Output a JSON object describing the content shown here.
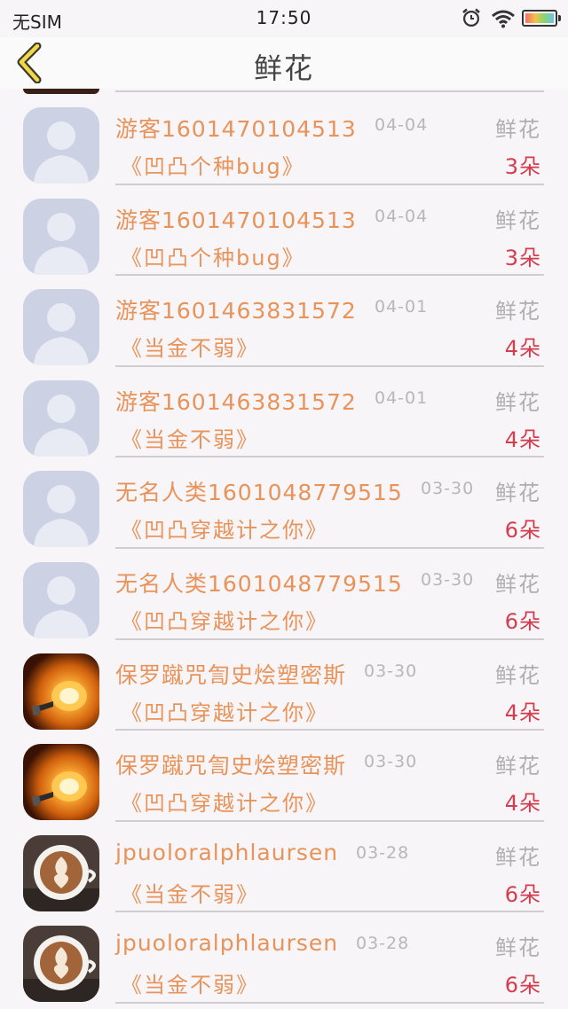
{
  "status_bar": {
    "carrier": "无SIM",
    "time": "17:50"
  },
  "nav": {
    "title": "鲜花"
  },
  "rows": [
    {
      "name": "游客1601470104513",
      "date": "04-04",
      "gift": "鲜花",
      "title": "《凹凸个种bug》",
      "count": "3朵",
      "avatar": "default-avatar"
    },
    {
      "name": "游客1601470104513",
      "date": "04-04",
      "gift": "鲜花",
      "title": "《凹凸个种bug》",
      "count": "3朵",
      "avatar": "default-avatar"
    },
    {
      "name": "游客1601463831572",
      "date": "04-01",
      "gift": "鲜花",
      "title": "《当金不弱》",
      "count": "4朵",
      "avatar": "default-avatar"
    },
    {
      "name": "游客1601463831572",
      "date": "04-01",
      "gift": "鲜花",
      "title": "《当金不弱》",
      "count": "4朵",
      "avatar": "default-avatar"
    },
    {
      "name": "无名人类1601048779515",
      "date": "03-30",
      "gift": "鲜花",
      "title": "《凹凸穿越计之你》",
      "count": "6朵",
      "avatar": "default-avatar"
    },
    {
      "name": "无名人类1601048779515",
      "date": "03-30",
      "gift": "鲜花",
      "title": "《凹凸穿越计之你》",
      "count": "6朵",
      "avatar": "default-avatar"
    },
    {
      "name": "保罗蹴咒訇史烩塑密斯",
      "date": "03-30",
      "gift": "鲜花",
      "title": "《凹凸穿越计之你》",
      "count": "4朵",
      "avatar": "lightbulb-avatar"
    },
    {
      "name": "保罗蹴咒訇史烩塑密斯",
      "date": "03-30",
      "gift": "鲜花",
      "title": "《凹凸穿越计之你》",
      "count": "4朵",
      "avatar": "lightbulb-avatar"
    },
    {
      "name": "jpuoloralphlaursen",
      "date": "03-28",
      "gift": "鲜花",
      "title": "《当金不弱》",
      "count": "6朵",
      "avatar": "coffee-avatar"
    },
    {
      "name": "jpuoloralphlaursen",
      "date": "03-28",
      "gift": "鲜花",
      "title": "《当金不弱》",
      "count": "6朵",
      "avatar": "coffee-avatar"
    }
  ]
}
